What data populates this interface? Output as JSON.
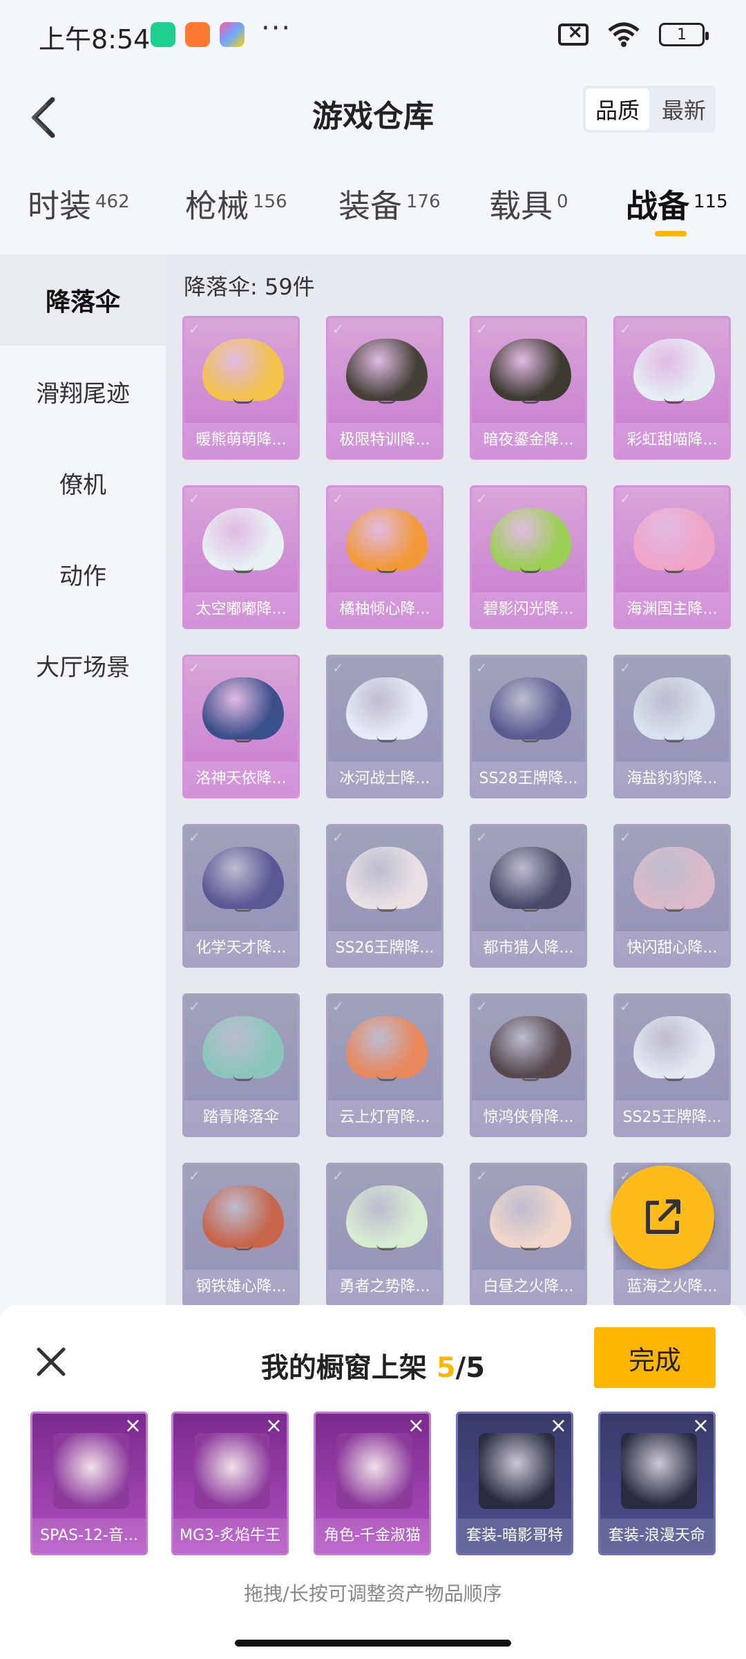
{
  "status": {
    "time": "上午8:54",
    "more": "···",
    "battery": "1"
  },
  "header": {
    "title": "游戏仓库",
    "sort_options": [
      "品质",
      "最新"
    ],
    "sort_active": "品质"
  },
  "tabs": [
    {
      "label": "时装",
      "count": "462"
    },
    {
      "label": "枪械",
      "count": "156"
    },
    {
      "label": "装备",
      "count": "176"
    },
    {
      "label": "载具",
      "count": "0"
    },
    {
      "label": "战备",
      "count": "115"
    }
  ],
  "sidebar": {
    "items": [
      {
        "label": "降落伞"
      },
      {
        "label": "滑翔尾迹"
      },
      {
        "label": "僚机"
      },
      {
        "label": "动作"
      },
      {
        "label": "大厅场景"
      }
    ]
  },
  "main": {
    "count_label": "降落伞: 59件",
    "items": [
      {
        "name": "暖熊萌萌降...",
        "owned": true,
        "color": "#f2c24a"
      },
      {
        "name": "极限特训降...",
        "owned": true,
        "color": "#444038"
      },
      {
        "name": "暗夜鎏金降...",
        "owned": true,
        "color": "#3d3a32"
      },
      {
        "name": "彩虹甜喵降...",
        "owned": true,
        "color": "#e6eef4"
      },
      {
        "name": "太空嘟嘟降...",
        "owned": true,
        "color": "#e8f0f4"
      },
      {
        "name": "橘柚倾心降...",
        "owned": true,
        "color": "#f29a3a"
      },
      {
        "name": "碧影闪光降...",
        "owned": true,
        "color": "#9ccf55"
      },
      {
        "name": "海渊国主降...",
        "owned": true,
        "color": "#f0a5c8"
      },
      {
        "name": "洛神天依降...",
        "owned": true,
        "color": "#3b4f8a"
      },
      {
        "name": "冰河战士降...",
        "owned": false,
        "color": "#e8ecf8"
      },
      {
        "name": "SS28王牌降...",
        "owned": false,
        "color": "#4e4f88"
      },
      {
        "name": "海盐豹豹降...",
        "owned": false,
        "color": "#d8e3f0"
      },
      {
        "name": "化学天才降...",
        "owned": false,
        "color": "#4f4b8e"
      },
      {
        "name": "SS26王牌降...",
        "owned": false,
        "color": "#e9e0e4"
      },
      {
        "name": "都市猎人降...",
        "owned": false,
        "color": "#3c3d5e"
      },
      {
        "name": "快闪甜心降...",
        "owned": false,
        "color": "#d9b7c6"
      },
      {
        "name": "踏青降落伞",
        "owned": false,
        "color": "#82c4b8"
      },
      {
        "name": "云上灯宵降...",
        "owned": false,
        "color": "#e98050"
      },
      {
        "name": "惊鸿侠骨降...",
        "owned": false,
        "color": "#4a3a40"
      },
      {
        "name": "SS25王牌降...",
        "owned": false,
        "color": "#e4e8f2"
      },
      {
        "name": "钢铁雄心降...",
        "owned": false,
        "color": "#c45a3c"
      },
      {
        "name": "勇者之势降...",
        "owned": false,
        "color": "#d8ecd0"
      },
      {
        "name": "白昼之火降...",
        "owned": false,
        "color": "#f2d6c8"
      },
      {
        "name": "蓝海之火降...",
        "owned": false,
        "color": "#5f6fa8"
      }
    ]
  },
  "sheet": {
    "title_prefix": "我的橱窗上架 ",
    "count": "5",
    "title_suffix": "/5",
    "done_label": "完成",
    "hint": "拖拽/长按可调整资产物品顺序",
    "items": [
      {
        "name": "SPAS-12-音...",
        "style": "purple"
      },
      {
        "name": "MG3-炙焰牛王",
        "style": "purple"
      },
      {
        "name": "角色-千金淑猫",
        "style": "purple"
      },
      {
        "name": "套装-暗影哥特",
        "style": "blue"
      },
      {
        "name": "套装-浪漫天命",
        "style": "blue"
      }
    ]
  },
  "colors": {
    "accent": "#ffb600",
    "owned_card": "#c87ad0",
    "locked_card": "#8d89b5"
  }
}
